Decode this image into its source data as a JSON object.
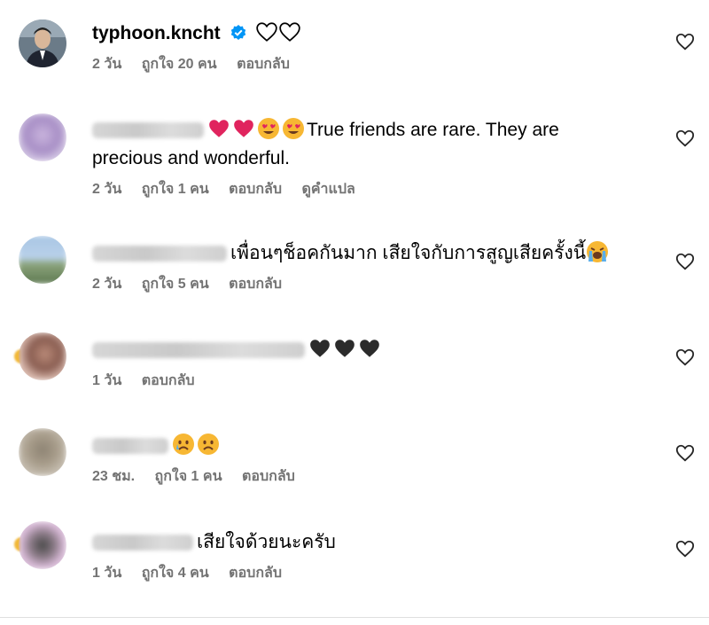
{
  "comments": [
    {
      "username": "typhoon.kncht",
      "verified": true,
      "text": "",
      "meta": [
        "2 วัน",
        "ถูกใจ 20 คน",
        "ตอบกลับ"
      ]
    },
    {
      "username": "",
      "text": "True friends are rare. They are",
      "text2": "precious and wonderful.",
      "meta": [
        "2 วัน",
        "ถูกใจ 1 คน",
        "ตอบกลับ",
        "ดูคำแปล"
      ]
    },
    {
      "username": "",
      "text": "เพื่อนๆช็อคกันมาก เสียใจกับการสูญเสียครั้งนี้",
      "meta": [
        "2 วัน",
        "ถูกใจ 5 คน",
        "ตอบกลับ"
      ]
    },
    {
      "username": "",
      "text": "",
      "meta": [
        "1 วัน",
        "ตอบกลับ"
      ]
    },
    {
      "username": "",
      "text": "",
      "meta": [
        "23 ชม.",
        "ถูกใจ 1 คน",
        "ตอบกลับ"
      ]
    },
    {
      "username": "",
      "text": "เสียใจด้วยนะครับ",
      "meta": [
        "1 วัน",
        "ถูกใจ 4 คน",
        "ตอบกลับ"
      ]
    }
  ],
  "icons": {
    "like": "heart-outline-icon",
    "verified": "verified-badge-icon"
  },
  "colors": {
    "verified": "#0095f6",
    "meta": "#737373",
    "red_heart": "#e0245e",
    "black_heart": "#2b2b2b"
  }
}
